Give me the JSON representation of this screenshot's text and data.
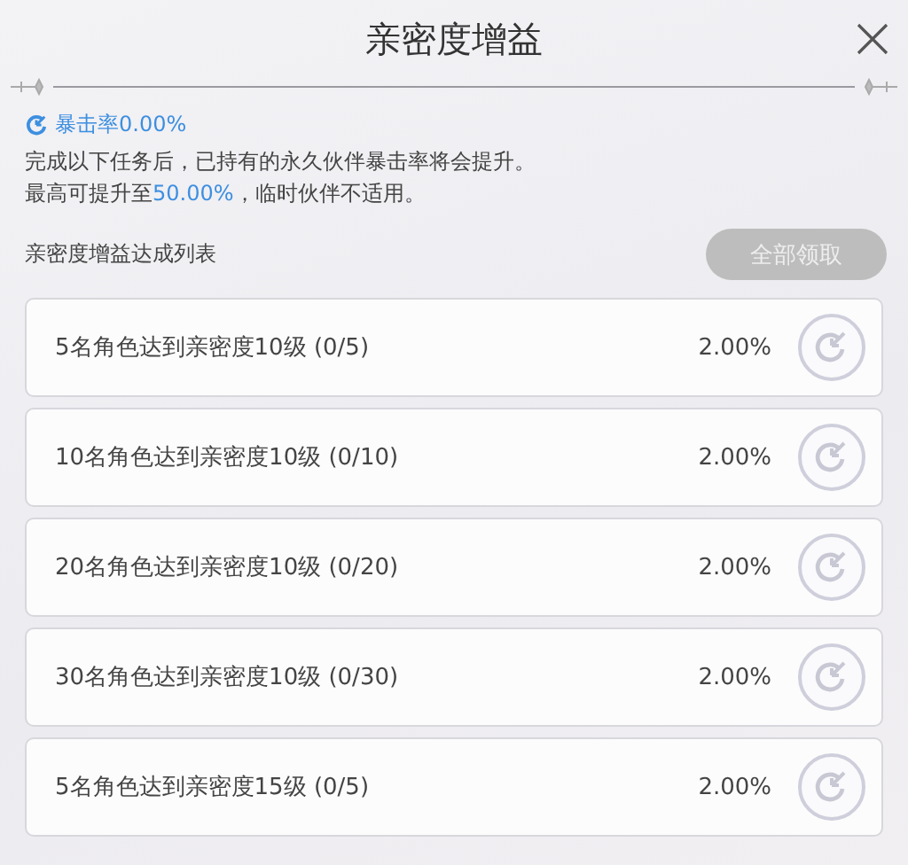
{
  "dialog": {
    "title": "亲密度增益"
  },
  "stat": {
    "label": "暴击率0.00%"
  },
  "description": {
    "line1": "完成以下任务后，已持有的永久伙伴暴击率将会提升。",
    "line2_before": "最高可提升至",
    "line2_highlight": "50.00%",
    "line2_after": "，临时伙伴不适用。"
  },
  "list": {
    "title": "亲密度增益达成列表",
    "claim_all": {
      "label": "全部领取",
      "disabled": true
    },
    "rows": [
      {
        "task": "5名角色达到亲密度10级 (0/5)",
        "bonus": "2.00%",
        "claimable": false
      },
      {
        "task": "10名角色达到亲密度10级 (0/10)",
        "bonus": "2.00%",
        "claimable": false
      },
      {
        "task": "20名角色达到亲密度10级 (0/20)",
        "bonus": "2.00%",
        "claimable": false
      },
      {
        "task": "30名角色达到亲密度10级 (0/30)",
        "bonus": "2.00%",
        "claimable": false
      },
      {
        "task": "5名角色达到亲密度15级 (0/5)",
        "bonus": "2.00%",
        "claimable": false
      }
    ]
  }
}
